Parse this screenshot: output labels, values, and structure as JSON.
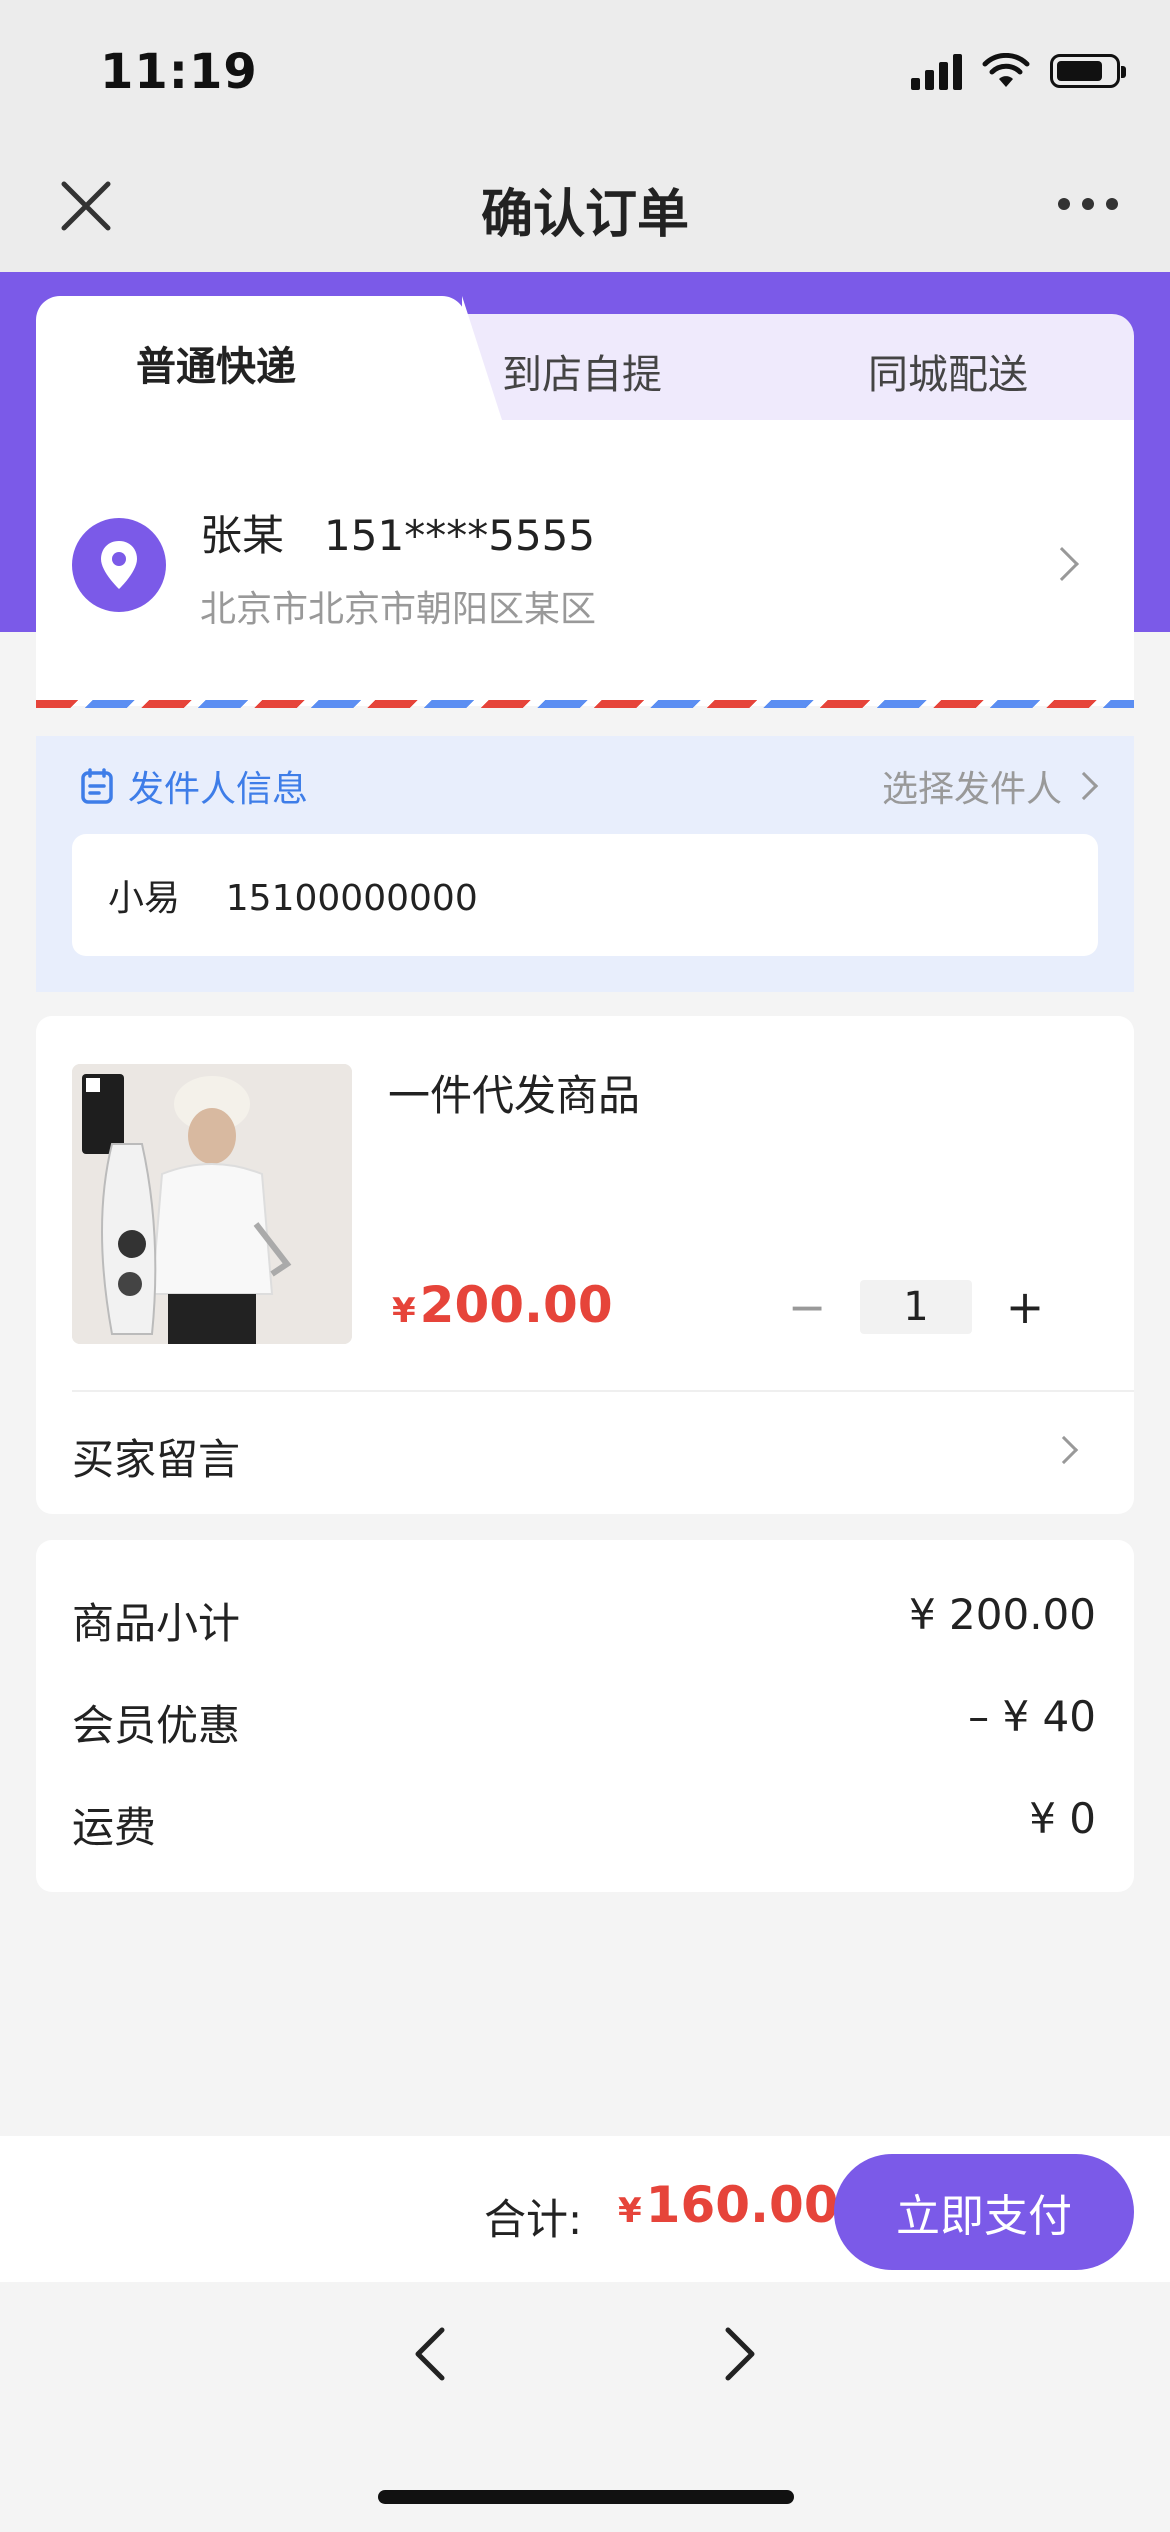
{
  "status_bar": {
    "time": "11:19"
  },
  "nav": {
    "title": "确认订单",
    "close_icon": "close-icon",
    "more_icon": "more-icon"
  },
  "tabs": [
    {
      "label": "普通快递",
      "active": true
    },
    {
      "label": "到店自提",
      "active": false
    },
    {
      "label": "同城配送",
      "active": false
    }
  ],
  "address": {
    "name_phone": "张某   151****5555",
    "detail": "北京市北京市朝阳区某区"
  },
  "sender": {
    "label": "发件人信息",
    "select_label": "选择发件人",
    "value": "小易    15100000000"
  },
  "product": {
    "title": "一件代发商品",
    "currency": "¥",
    "price": "200.00",
    "quantity": "1",
    "minus": "−",
    "plus": "+"
  },
  "buyer_message": {
    "label": "买家留言"
  },
  "summary": [
    {
      "label": "商品小计",
      "value": "¥ 200.00"
    },
    {
      "label": "会员优惠",
      "value": "– ¥ 40"
    },
    {
      "label": "运费",
      "value": "¥ 0"
    }
  ],
  "footer": {
    "total_label": "合计:",
    "currency": "¥",
    "total": "160.00",
    "pay_button": "立即支付"
  },
  "colors": {
    "accent": "#7b5ae8",
    "price": "#e6443a",
    "link_blue": "#3e7de8"
  }
}
